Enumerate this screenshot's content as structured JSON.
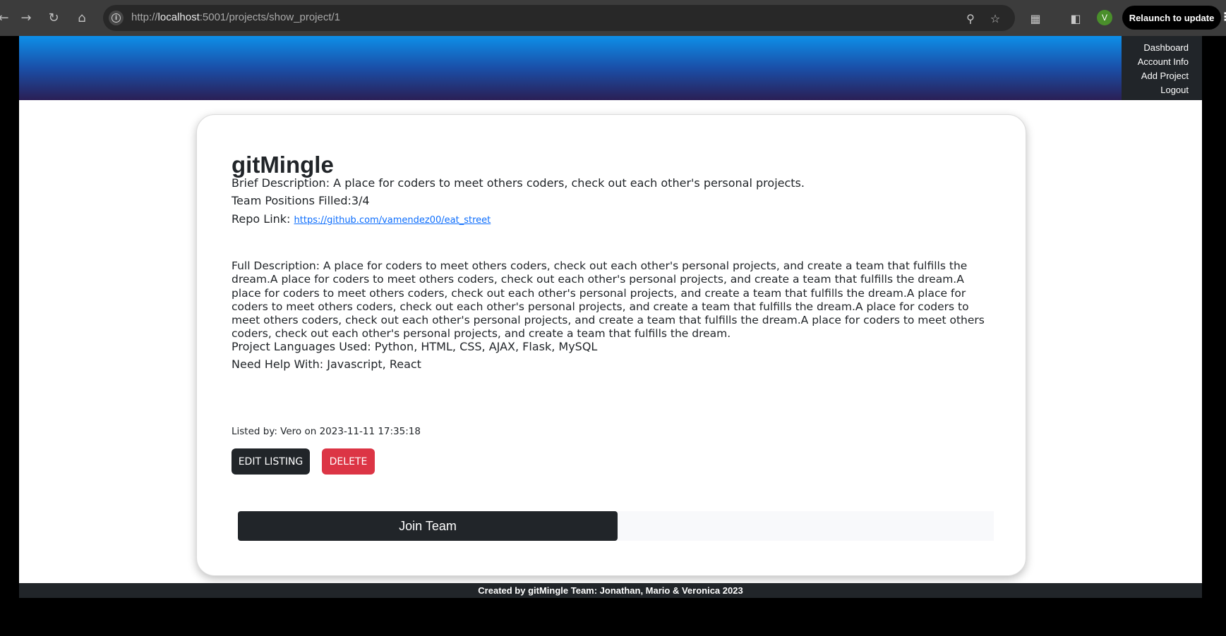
{
  "browser": {
    "url_prefix": "http://",
    "url_host": "localhost",
    "url_rest": ":5001/projects/show_project/1",
    "profile_initial": "V",
    "relaunch_label": "Relaunch to update"
  },
  "nav": {
    "items": [
      "Dashboard",
      "Account Info",
      "Add Project",
      "Logout"
    ]
  },
  "project": {
    "name": "gitMingle",
    "brief": "Brief Description: A place for coders to meet others coders, check out each other's personal projects.",
    "positions": "Team Positions Filled:3/4",
    "repo_label": "Repo Link: ",
    "repo_url": "https://github.com/vamendez00/eat_street",
    "full_description": "Full Description: A place for coders to meet others coders, check out each other's personal projects, and create a team that fulfills the dream.A place for coders to meet others coders, check out each other's personal projects, and create a team that fulfills the dream.A place for coders to meet others coders, check out each other's personal projects, and create a team that fulfills the dream.A place for coders to meet others coders, check out each other's personal projects, and create a team that fulfills the dream.A place for coders to meet others coders, check out each other's personal projects, and create a team that fulfills the dream.A place for coders to meet others coders, check out each other's personal projects, and create a team that fulfills the dream.",
    "languages": "Project Languages Used: Python, HTML, CSS, AJAX, Flask, MySQL",
    "need_help": "Need Help With: Javascript, React",
    "listed_by": "Listed by: Vero on 2023-11-11 17:35:18"
  },
  "actions": {
    "edit_label": "EDIT LISTING",
    "delete_label": "DELETE",
    "join_label": "Join Team"
  },
  "footer": {
    "text": "Created by gitMingle Team: Jonathan, Mario & Veronica 2023"
  },
  "colors": {
    "dark": "#212529",
    "danger": "#dc3545",
    "link": "#0d6efd"
  }
}
